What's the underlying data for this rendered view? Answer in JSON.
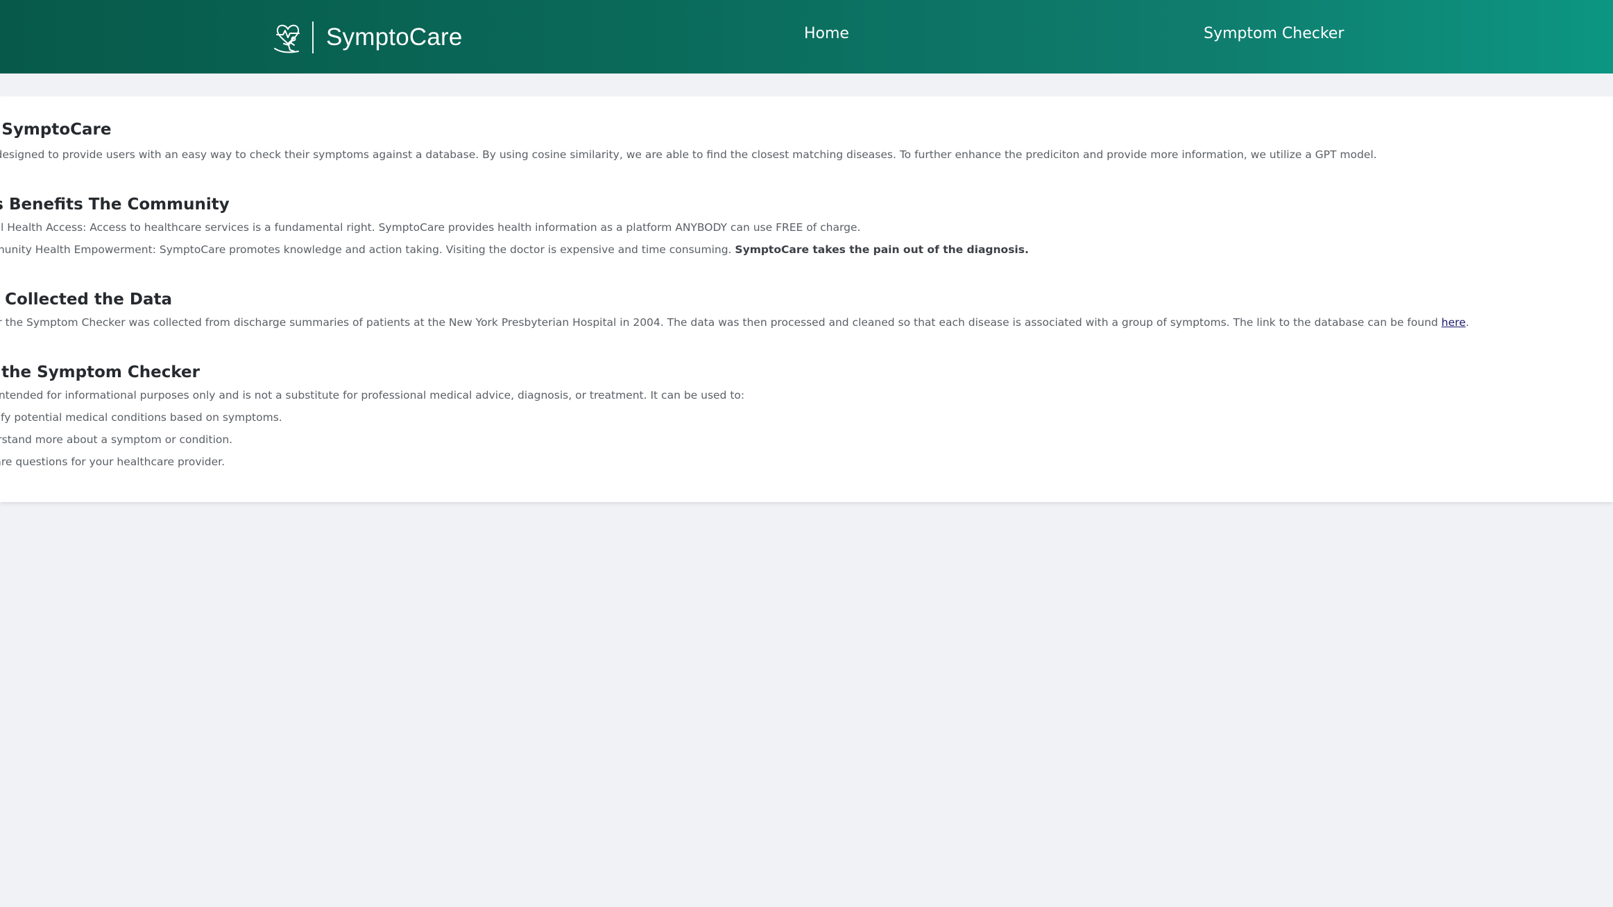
{
  "navbar": {
    "brand_name": "SymptoCare",
    "logo_icon": "heart-pulse-runner-icon",
    "links": [
      "Home",
      "Symptom Checker"
    ],
    "gradient_colors": [
      "#075a4a",
      "#0c9682"
    ]
  },
  "about": {
    "title": "ut SymptoCare",
    "text": "l is designed to provide users with an easy way to check their symptoms against a database. By using cosine similarity, we are able to find the closest matching diseases. To further enhance the prediciton and provide more information, we utilize a GPT model."
  },
  "benefits": {
    "title": "his Benefits The Community",
    "item1": "igital Health Access: Access to healthcare services is a fundamental right. SymptoCare provides health information as a platform ANYBODY can use FREE of charge.",
    "item2_text": "ommunity Health Empowerment: SymptoCare promotes knowledge and action taking. Visiting the doctor is expensive and time consuming.",
    "item2_bold": "SymptoCare takes the pain out of the diagnosis."
  },
  "data_section": {
    "title": "Ve Collected the Data",
    "text": "a for the Symptom Checker was collected from discharge summaries of patients at the New York Presbyterian Hospital in 2004. The data was then processed and cleaned so that each disease is associated with a group of symptoms. The link to the database can be found",
    "link_text": "here",
    "end_punct": "."
  },
  "usage": {
    "title": "or the Symptom Checker",
    "intro": "l is intended for informational purposes only and is not a substitute for professional medical advice, diagnosis, or treatment. It can be used to:",
    "items": [
      "lentify potential medical conditions based on symptoms.",
      "nderstand more about a symptom or condition.",
      "repare questions for your healthcare provider."
    ]
  }
}
